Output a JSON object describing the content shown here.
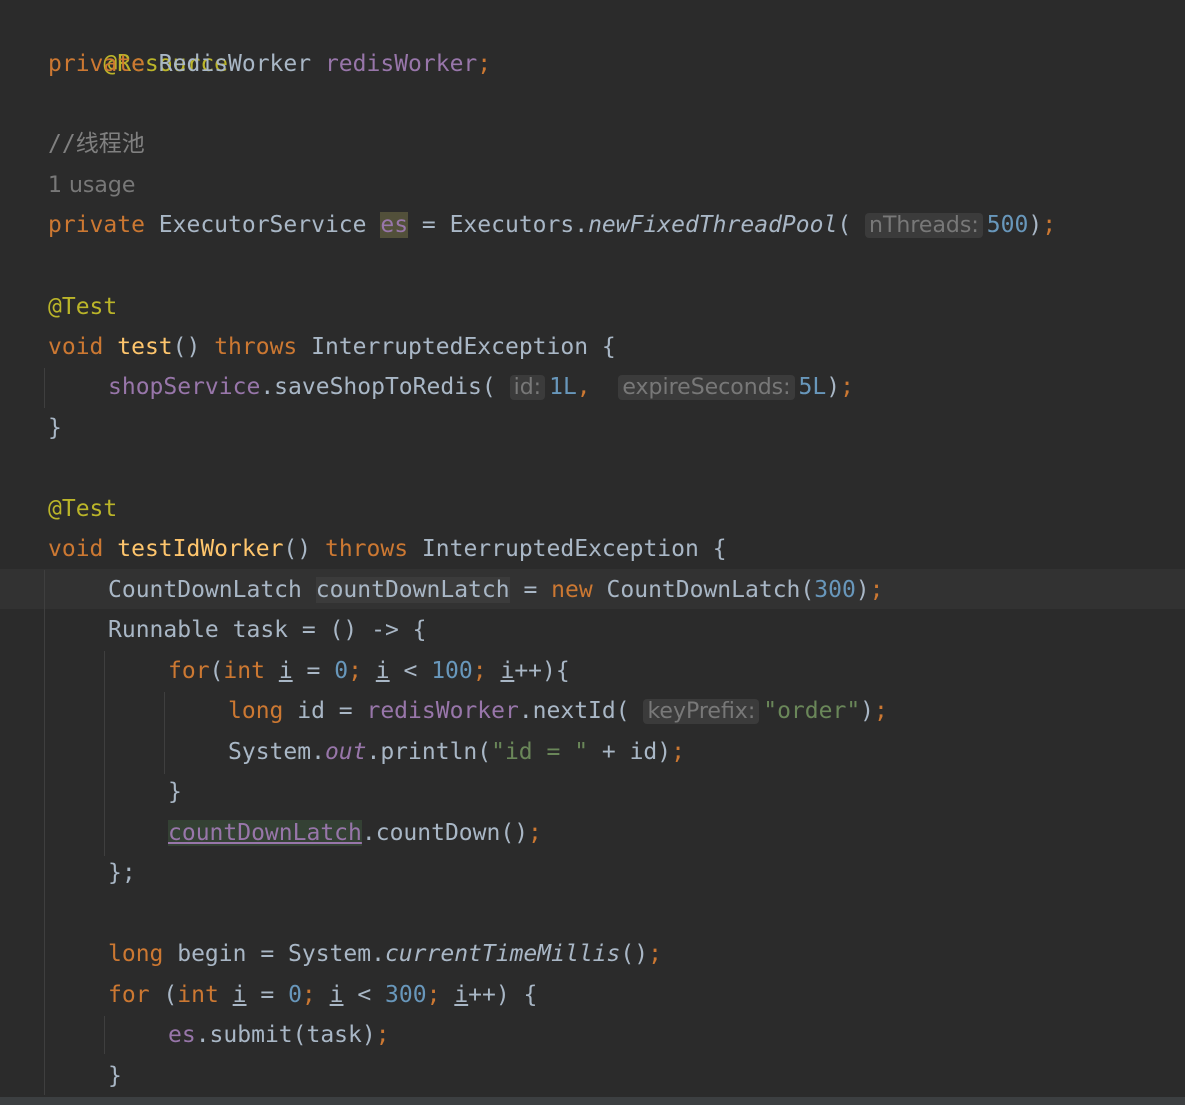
{
  "editor": {
    "lines": {
      "l1": {
        "annotation": "@Resource"
      },
      "l2": {
        "kw": "private",
        "type": " RedisWorker ",
        "field": "redisWorker",
        "semi": ";"
      },
      "l4": {
        "comment": "//线程池"
      },
      "l5": {
        "usage": "1 usage"
      },
      "l6": {
        "kw": "private",
        "type": " ExecutorService ",
        "field": "es",
        "eq": " = Executors.",
        "method": "newFixedThreadPool",
        "open": "(",
        "hint": "nThreads:",
        "num": "500",
        "close": ")",
        "semi": ";"
      },
      "l8": {
        "annotation": "@Test"
      },
      "l9": {
        "kw": "void",
        "sp": " ",
        "method": "test",
        "paren": "() ",
        "throws": "throws",
        "rest": " InterruptedException {"
      },
      "l10": {
        "field": "shopService",
        "call": ".saveShopToRedis(",
        "hint1": "id:",
        "num1": "1L",
        "comma": ",",
        "hint2": "expireSeconds:",
        "num2": "5L",
        "close": ")",
        "semi": ";"
      },
      "l11": {
        "brace": "}"
      },
      "l13": {
        "annotation": "@Test"
      },
      "l14": {
        "kw": "void",
        "sp": " ",
        "method": "testIdWorker",
        "paren": "() ",
        "throws": "throws",
        "rest": " InterruptedException {"
      },
      "l15": {
        "type": "CountDownLatch ",
        "var": "countDownLatch",
        "eq": " = ",
        "new": "new",
        "ctor": " CountDownLatch(",
        "num": "300",
        "close": ")",
        "semi": ";"
      },
      "l16": {
        "text": "Runnable task = () -> {"
      },
      "l17": {
        "kw": "for",
        "open": "(",
        "int": "int",
        "sp": " ",
        "i1": "i",
        "eq": " = ",
        "zero": "0",
        "semi1": ";",
        "sp2": " ",
        "i2": "i",
        "lt": " < ",
        "hundred": "100",
        "semi2": ";",
        "sp3": " ",
        "i3": "i",
        "inc": "++){"
      },
      "l18": {
        "kw": "long",
        "decl": " id = ",
        "field": "redisWorker",
        "call": ".nextId(",
        "hint": "keyPrefix:",
        "str": "\"order\"",
        "close": ")",
        "semi": ";"
      },
      "l19": {
        "sys": "System.",
        "out": "out",
        "call": ".println(",
        "str": "\"id = \"",
        "rest": " + id)",
        "semi": ";"
      },
      "l20": {
        "brace": "}"
      },
      "l21": {
        "var": "countDownLatch",
        "call": ".countDown()",
        "semi": ";"
      },
      "l22": {
        "text": "};"
      },
      "l24": {
        "kw": "long",
        "decl": " begin = System.",
        "method": "currentTimeMillis",
        "paren": "()",
        "semi": ";"
      },
      "l25": {
        "kw": "for",
        "sp": " (",
        "int": "int",
        "sp1": " ",
        "i1": "i",
        "eq": " = ",
        "zero": "0",
        "semi1": ";",
        "sp2": " ",
        "i2": "i",
        "lt": " < ",
        "num": "300",
        "semi2": ";",
        "sp3": " ",
        "i3": "i",
        "inc": "++) {"
      },
      "l26": {
        "field": "es",
        "call": ".submit(task)",
        "semi": ";"
      },
      "l27": {
        "brace": "}"
      }
    }
  }
}
